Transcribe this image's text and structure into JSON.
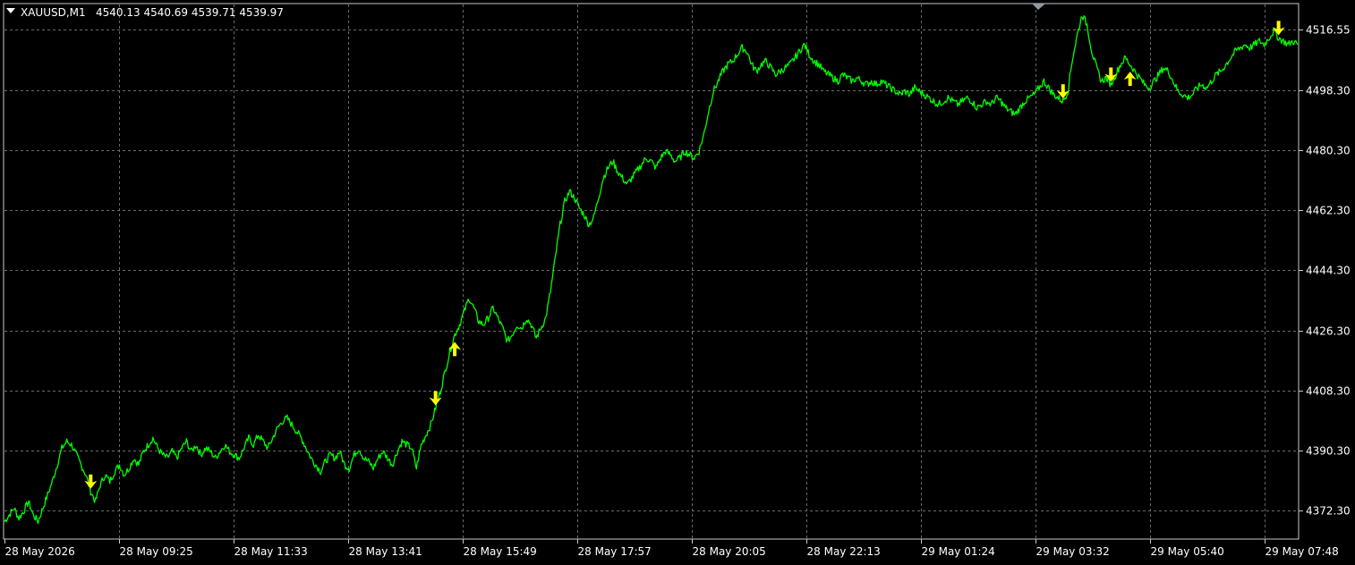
{
  "header": {
    "symbol": "XAUUSD,M1",
    "ohlc": "4540.13 4540.69 4539.71 4539.97"
  },
  "colors": {
    "background": "#000000",
    "grid": "#6a6a6a",
    "frame": "#c8c8c8",
    "price_line": "#00ff00",
    "arrow": "#ffff00",
    "text": "#ffffff"
  },
  "chart_data": {
    "type": "line",
    "title": "XAUUSD,M1",
    "ylim": [
      4364,
      4524
    ],
    "y_ticks": [
      {
        "value": 4516.55,
        "label": "4516.55"
      },
      {
        "value": 4498.3,
        "label": "4498.30"
      },
      {
        "value": 4480.3,
        "label": "4480.30"
      },
      {
        "value": 4462.3,
        "label": "4462.30"
      },
      {
        "value": 4444.3,
        "label": "4444.30"
      },
      {
        "value": 4426.3,
        "label": "4426.30"
      },
      {
        "value": 4408.3,
        "label": "4408.30"
      },
      {
        "value": 4390.3,
        "label": "4390.30"
      },
      {
        "value": 4372.3,
        "label": "4372.30"
      }
    ],
    "x_ticks": [
      "28 May 2026",
      "28 May 09:25",
      "28 May 11:33",
      "28 May 13:41",
      "28 May 15:49",
      "28 May 17:57",
      "28 May 20:05",
      "28 May 22:13",
      "29 May 01:24",
      "29 May 03:32",
      "29 May 05:40",
      "29 May 07:48"
    ],
    "grid": true,
    "series": [
      {
        "values": [
          4369,
          4371,
          4373,
          4370,
          4372,
          4375,
          4371,
          4369,
          4373,
          4377,
          4381,
          4386,
          4391,
          4393,
          4392,
          4389,
          4386,
          4383,
          4378,
          4375,
          4380,
          4383,
          4381,
          4384,
          4386,
          4383,
          4385,
          4388,
          4386,
          4390,
          4392,
          4394,
          4391,
          4389,
          4388,
          4390,
          4388,
          4391,
          4393,
          4390,
          4392,
          4389,
          4391,
          4390,
          4388,
          4390,
          4392,
          4390,
          4389,
          4388,
          4391,
          4394,
          4392,
          4395,
          4393,
          4391,
          4394,
          4397,
          4399,
          4400,
          4398,
          4396,
          4394,
          4391,
          4388,
          4386,
          4384,
          4387,
          4389,
          4388,
          4390,
          4386,
          4385,
          4389,
          4391,
          4388,
          4387,
          4385,
          4388,
          4390,
          4388,
          4386,
          4390,
          4393,
          4392,
          4391,
          4385,
          4392,
          4395,
          4398,
          4403,
          4408,
          4414,
          4420,
          4425,
          4428,
          4432,
          4436,
          4433,
          4429,
          4428,
          4430,
          4433,
          4430,
          4427,
          4423,
          4425,
          4428,
          4427,
          4430,
          4428,
          4424,
          4427,
          4430,
          4438,
          4448,
          4458,
          4465,
          4468,
          4466,
          4463,
          4461,
          4458,
          4460,
          4466,
          4472,
          4475,
          4477,
          4474,
          4472,
          4470,
          4472,
          4474,
          4476,
          4478,
          4477,
          4475,
          4478,
          4480,
          4479,
          4477,
          4478,
          4480,
          4479,
          4478,
          4480,
          4485,
          4492,
          4498,
          4501,
          4504,
          4506,
          4507,
          4509,
          4511,
          4510,
          4506,
          4504,
          4506,
          4507,
          4505,
          4503,
          4504,
          4505,
          4506,
          4508,
          4510,
          4512,
          4509,
          4507,
          4506,
          4504,
          4503,
          4502,
          4501,
          4503,
          4502,
          4501,
          4502,
          4501,
          4500,
          4501,
          4500,
          4501,
          4500,
          4499,
          4498,
          4497,
          4498,
          4497,
          4499,
          4498,
          4497,
          4496,
          4495,
          4494,
          4495,
          4496,
          4495,
          4494,
          4495,
          4496,
          4495,
          4493,
          4494,
          4495,
          4494,
          4496,
          4495,
          4493,
          4492,
          4491,
          4493,
          4495,
          4496,
          4497,
          4499,
          4501,
          4499,
          4497,
          4496,
          4495,
          4498,
          4508,
          4515,
          4521,
          4518,
          4510,
          4505,
          4501,
          4502,
          4500,
          4503,
          4506,
          4508,
          4506,
          4504,
          4502,
          4500,
          4499,
          4501,
          4503,
          4505,
          4504,
          4501,
          4498,
          4497,
          4496,
          4497,
          4499,
          4500,
          4499,
          4501,
          4503,
          4504,
          4506,
          4508,
          4510,
          4511,
          4512,
          4511,
          4512,
          4513,
          4512,
          4514,
          4516,
          4514,
          4513,
          4512,
          4513,
          4512
        ]
      }
    ],
    "arrows": [
      {
        "dir": "down",
        "index": 18
      },
      {
        "dir": "down",
        "index": 90
      },
      {
        "dir": "up",
        "index": 94
      },
      {
        "dir": "down",
        "index": 221
      },
      {
        "dir": "down",
        "index": 231
      },
      {
        "dir": "up",
        "index": 235
      },
      {
        "dir": "down",
        "index": 266
      }
    ]
  }
}
